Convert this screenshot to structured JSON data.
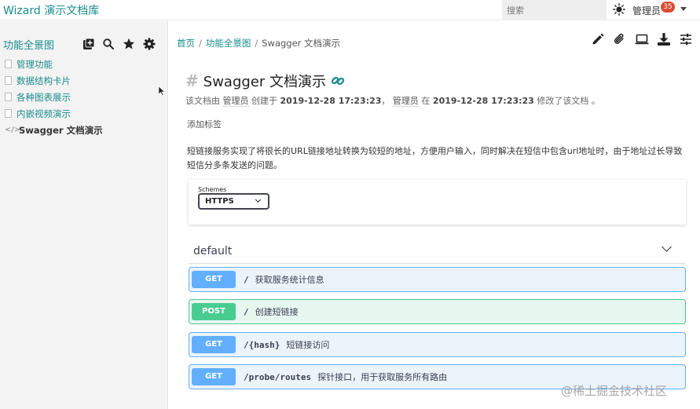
{
  "app": {
    "title": "Wizard 演示文档库"
  },
  "header": {
    "search_placeholder": "搜索",
    "user_name": "管理员",
    "notification_count": "35",
    "badge_color": "#e04b32"
  },
  "sidebar": {
    "title": "功能全景图",
    "tools": [
      "add-icon",
      "search-icon",
      "star-icon",
      "gear-icon"
    ],
    "items": [
      {
        "label": "管理功能"
      },
      {
        "label": "数据结构卡片"
      },
      {
        "label": "各种图表展示"
      },
      {
        "label": "内嵌视频演示"
      },
      {
        "label": "Swagger 文档演示",
        "active": true
      }
    ]
  },
  "breadcrumb": {
    "home": "首页",
    "parent": "功能全景图",
    "current": "Swagger 文档演示",
    "separator": "/"
  },
  "toolbar": {
    "icons": [
      "edit-icon",
      "attach-icon",
      "present-icon",
      "download-icon",
      "settings-sliders-icon"
    ]
  },
  "page": {
    "title": "Swagger 文档演示",
    "meta": {
      "prefix": "该文档由",
      "creator": "管理员",
      "created_word": "创建于",
      "created_at": "2019-12-28 17:23:23",
      "sep": "，",
      "modifier": "管理员",
      "at_word": "在",
      "modified_at": "2019-12-28 17:23:23",
      "suffix": "修改了该文档 。"
    },
    "add_tag": "添加标签",
    "description": "短链接服务实现了将很长的URL链接地址转换为较短的地址，方便用户输入，同时解决在短信中包含url地址时，由于地址过长导致短信分多条发送的问题。"
  },
  "schemes": {
    "label": "Schemes",
    "selected": "HTTPS"
  },
  "section": {
    "name": "default"
  },
  "operations": [
    {
      "method": "GET",
      "path": "/",
      "summary": "获取服务统计信息"
    },
    {
      "method": "POST",
      "path": "/",
      "summary": "创建短链接"
    },
    {
      "method": "GET",
      "path": "/{hash}",
      "summary": "短链接访问"
    },
    {
      "method": "GET",
      "path": "/probe/routes",
      "summary": "探针接口，用于获取服务所有路由"
    }
  ],
  "colors": {
    "accent": "#1a8c8c",
    "get": "#61affe",
    "post": "#49cc90"
  },
  "watermark": "@稀土掘金技术社区"
}
